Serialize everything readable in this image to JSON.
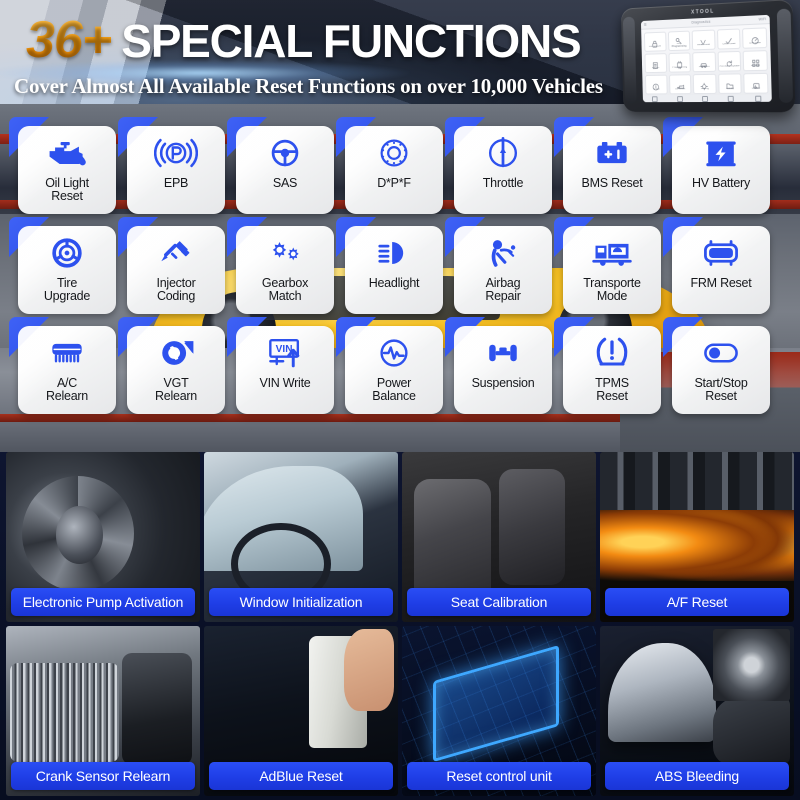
{
  "header": {
    "badge": "36+",
    "title": "SPECIAL FUNCTIONS",
    "subtitle": "Cover Almost All Available Reset Functions on over 10,000 Vehicles",
    "badge_color": "#f59a0b",
    "accent_color": "#2a4ef5"
  },
  "tablet": {
    "brand": "XTOOL",
    "status_title": "Diagnostics",
    "signal": "WiFi",
    "apps": [
      {
        "label": "Immobilizer",
        "icon": "lock-icon"
      },
      {
        "label": "Key Programming",
        "icon": "key-icon"
      },
      {
        "label": "Read Code",
        "icon": "checkmark-icon"
      },
      {
        "label": "Clear Code",
        "icon": "check-icon"
      },
      {
        "label": "Live Data",
        "icon": "gauge-icon"
      },
      {
        "label": "Report",
        "icon": "document-icon"
      },
      {
        "label": "Programming",
        "icon": "chip-icon"
      },
      {
        "label": "Actuation",
        "icon": "car-icon"
      },
      {
        "label": "Firmware Update",
        "icon": "refresh-icon"
      },
      {
        "label": "Module",
        "icon": "grid-icon"
      },
      {
        "label": "TPMS",
        "icon": "info-icon"
      },
      {
        "label": "Oil Reset",
        "icon": "oil-icon"
      },
      {
        "label": "Setting",
        "icon": "gear-icon"
      },
      {
        "label": "Library",
        "icon": "folder-icon"
      },
      {
        "label": "Battery",
        "icon": "battery-icon"
      }
    ],
    "nav": [
      "back-icon",
      "home-icon",
      "recents-icon",
      "screenshot-icon",
      "settings-icon"
    ]
  },
  "functions": [
    {
      "label": "Oil Light\nReset",
      "icon": "oil-can-icon"
    },
    {
      "label": "EPB",
      "icon": "parking-brake-icon"
    },
    {
      "label": "SAS",
      "icon": "steering-wheel-icon"
    },
    {
      "label": "D*P*F",
      "icon": "dpf-filter-icon"
    },
    {
      "label": "Throttle",
      "icon": "throttle-icon"
    },
    {
      "label": "BMS Reset",
      "icon": "battery-icon"
    },
    {
      "label": "HV Battery",
      "icon": "hv-battery-icon"
    },
    {
      "label": "Tire\nUpgrade",
      "icon": "tire-icon"
    },
    {
      "label": "Injector\nCoding",
      "icon": "injector-icon"
    },
    {
      "label": "Gearbox\nMatch",
      "icon": "gears-icon"
    },
    {
      "label": "Headlight",
      "icon": "headlight-icon"
    },
    {
      "label": "Airbag\nRepair",
      "icon": "airbag-icon"
    },
    {
      "label": "Transporte\nMode",
      "icon": "transporter-icon"
    },
    {
      "label": "FRM Reset",
      "icon": "frm-module-icon"
    },
    {
      "label": "A/C\nRelearn",
      "icon": "air-conditioner-icon"
    },
    {
      "label": "VGT\nRelearn",
      "icon": "turbo-icon"
    },
    {
      "label": "VIN Write",
      "icon": "vin-write-icon"
    },
    {
      "label": "Power\nBalance",
      "icon": "power-balance-icon"
    },
    {
      "label": "Suspension",
      "icon": "suspension-icon"
    },
    {
      "label": "TPMS\nReset",
      "icon": "tpms-icon"
    },
    {
      "label": "Start/Stop\nReset",
      "icon": "toggle-icon"
    }
  ],
  "photos": [
    {
      "caption": "Electronic Pump Activation",
      "art": "art-pump"
    },
    {
      "caption": "Window Initialization",
      "art": "art-window"
    },
    {
      "caption": "Seat Calibration",
      "art": "art-seat"
    },
    {
      "caption": "A/F Reset",
      "art": "art-af"
    },
    {
      "caption": "Crank Sensor Relearn",
      "art": "art-crank"
    },
    {
      "caption": "AdBlue Reset",
      "art": "art-adblue"
    },
    {
      "caption": "Reset control unit",
      "art": "art-ecu"
    },
    {
      "caption": "ABS Bleeding",
      "art": "art-abs"
    }
  ]
}
